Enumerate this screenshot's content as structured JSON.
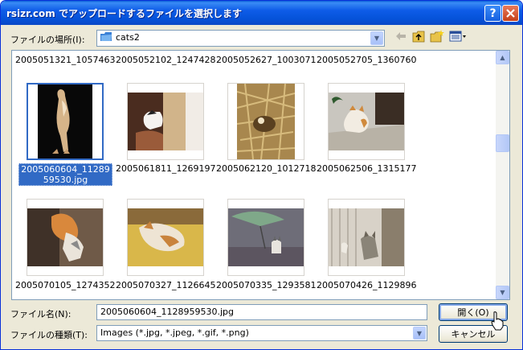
{
  "dialog": {
    "title": "rsizr.com でアップロードするファイルを選択します",
    "help_label": "?",
    "close_label": "✕"
  },
  "lookin": {
    "label": "ファイルの場所(I):",
    "value": "cats2",
    "folder_icon": "folder-icon"
  },
  "toolbar": {
    "icons": [
      "back-arrow-icon",
      "up-folder-icon",
      "new-folder-icon",
      "view-menu-icon"
    ]
  },
  "files": {
    "top_row": [
      "2005051321_10574630...",
      "2005052102_12474280...",
      "2005052627_10030711...",
      "2005052705_13607602..."
    ],
    "row1": [
      {
        "name": "2005060604_1128959530.jpg",
        "selected": true
      },
      {
        "name": "2005061811_12691970..."
      },
      {
        "name": "2005062120_10127183..."
      },
      {
        "name": "2005062506_13151775..."
      }
    ],
    "row2": [
      {
        "name": "2005070105_12743523..."
      },
      {
        "name": "2005070327_11266452..."
      },
      {
        "name": "2005070335_12935812..."
      },
      {
        "name": "2005070426_11298960..."
      }
    ]
  },
  "filename": {
    "label": "ファイル名(N):",
    "value": "2005060604_1128959530.jpg"
  },
  "filetype": {
    "label": "ファイルの種類(T):",
    "value": "Images (*.jpg, *.jpeg, *.gif, *.png)"
  },
  "buttons": {
    "open": "開く(O)",
    "cancel": "キャンセル"
  },
  "colors": {
    "title_bar": "#0552d9",
    "selection": "#316ac5",
    "dialog_bg": "#ece9d8"
  }
}
